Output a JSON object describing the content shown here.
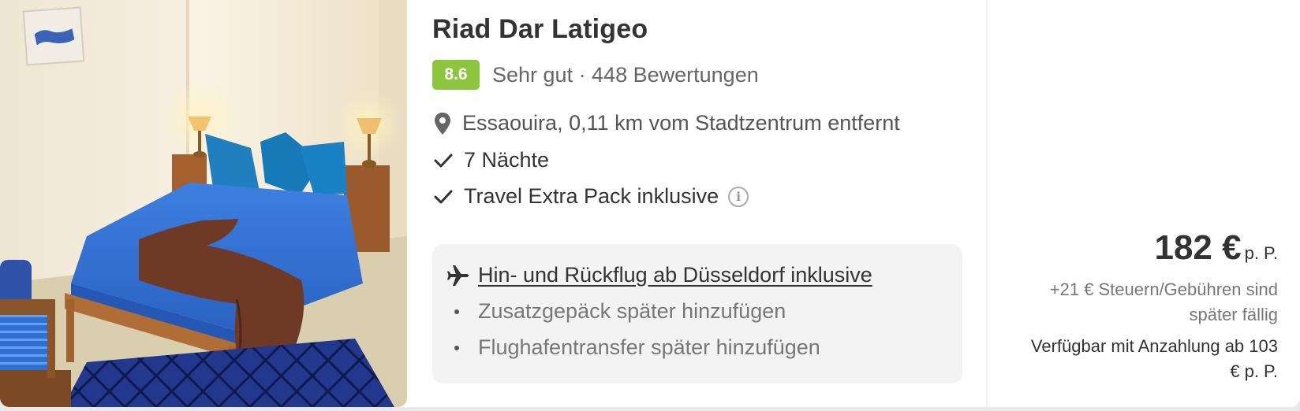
{
  "hotel": {
    "name": "Riad Dar Latigeo",
    "score": "8.6",
    "rating_text": "Sehr gut · 448 Bewertungen",
    "location": "Essaouira, 0,11 km vom Stadtzentrum entfernt"
  },
  "features": [
    {
      "label": "7 Nächte",
      "icon": "check-icon"
    },
    {
      "label": "Travel Extra Pack inklusive",
      "icon": "check-icon",
      "info_icon": "info-icon"
    }
  ],
  "flight": {
    "label": "Hin- und Rückflug ab Düsseldorf inklusive",
    "icon": "plane-icon",
    "addons": [
      "Zusatzgepäck später hinzufügen",
      "Flughafentransfer später hinzufügen"
    ]
  },
  "price": {
    "amount": "182 €",
    "unit": "p. P.",
    "taxes": "+21 € Steuern/Gebühren sind später fällig",
    "deposit": "Verfügbar mit Anzahlung ab 103 € p. P."
  },
  "colors": {
    "score_badge": "#8cc63f",
    "text_primary": "#333333",
    "text_secondary": "#777777",
    "flight_box_bg": "#f3f3f3"
  }
}
